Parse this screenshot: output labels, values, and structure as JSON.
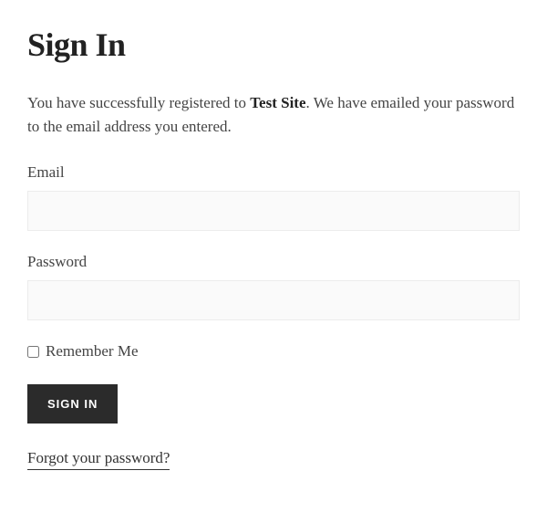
{
  "page": {
    "title": "Sign In"
  },
  "message": {
    "prefix": "You have successfully registered to ",
    "site_name": "Test Site",
    "suffix": ". We have emailed your password to the email address you entered."
  },
  "form": {
    "email": {
      "label": "Email",
      "value": ""
    },
    "password": {
      "label": "Password",
      "value": ""
    },
    "remember": {
      "label": "Remember Me"
    },
    "submit": {
      "label": "Sign In"
    }
  },
  "links": {
    "forgot_password": "Forgot your password?"
  }
}
